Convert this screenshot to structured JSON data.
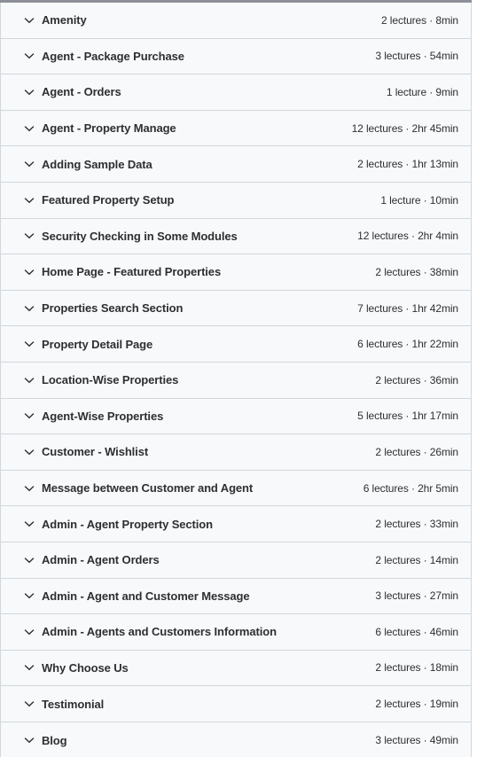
{
  "accordion": {
    "icon": "chevron-down-icon",
    "colors": {
      "row_background": "#f7f9fa",
      "border": "#d1d7dc",
      "title_text": "#2d2f31",
      "meta_text": "#2d2f31",
      "top_edge": "#8d9099"
    },
    "sections": [
      {
        "title": "Amenity",
        "lectures": "2 lectures",
        "duration": "8min",
        "meta": "2 lectures · 8min"
      },
      {
        "title": "Agent - Package Purchase",
        "lectures": "3 lectures",
        "duration": "54min",
        "meta": "3 lectures · 54min"
      },
      {
        "title": "Agent - Orders",
        "lectures": "1 lecture",
        "duration": "9min",
        "meta": "1 lecture · 9min"
      },
      {
        "title": "Agent - Property Manage",
        "lectures": "12 lectures",
        "duration": "2hr 45min",
        "meta": "12 lectures · 2hr 45min"
      },
      {
        "title": "Adding Sample Data",
        "lectures": "2 lectures",
        "duration": "1hr 13min",
        "meta": "2 lectures · 1hr 13min"
      },
      {
        "title": "Featured Property Setup",
        "lectures": "1 lecture",
        "duration": "10min",
        "meta": "1 lecture · 10min"
      },
      {
        "title": "Security Checking in Some Modules",
        "lectures": "12 lectures",
        "duration": "2hr 4min",
        "meta": "12 lectures · 2hr 4min"
      },
      {
        "title": "Home Page - Featured Properties",
        "lectures": "2 lectures",
        "duration": "38min",
        "meta": "2 lectures · 38min"
      },
      {
        "title": "Properties Search Section",
        "lectures": "7 lectures",
        "duration": "1hr 42min",
        "meta": "7 lectures · 1hr 42min"
      },
      {
        "title": "Property Detail Page",
        "lectures": "6 lectures",
        "duration": "1hr 22min",
        "meta": "6 lectures · 1hr 22min"
      },
      {
        "title": "Location-Wise Properties",
        "lectures": "2 lectures",
        "duration": "36min",
        "meta": "2 lectures · 36min"
      },
      {
        "title": "Agent-Wise Properties",
        "lectures": "5 lectures",
        "duration": "1hr 17min",
        "meta": "5 lectures · 1hr 17min"
      },
      {
        "title": "Customer - Wishlist",
        "lectures": "2 lectures",
        "duration": "26min",
        "meta": "2 lectures · 26min"
      },
      {
        "title": "Message between Customer and Agent",
        "lectures": "6 lectures",
        "duration": "2hr 5min",
        "meta": "6 lectures · 2hr 5min"
      },
      {
        "title": "Admin - Agent Property Section",
        "lectures": "2 lectures",
        "duration": "33min",
        "meta": "2 lectures · 33min"
      },
      {
        "title": "Admin - Agent Orders",
        "lectures": "2 lectures",
        "duration": "14min",
        "meta": "2 lectures · 14min"
      },
      {
        "title": "Admin - Agent and Customer Message",
        "lectures": "3 lectures",
        "duration": "27min",
        "meta": "3 lectures · 27min"
      },
      {
        "title": "Admin - Agents and Customers Information",
        "lectures": "6 lectures",
        "duration": "46min",
        "meta": "6 lectures · 46min"
      },
      {
        "title": "Why Choose Us",
        "lectures": "2 lectures",
        "duration": "18min",
        "meta": "2 lectures · 18min"
      },
      {
        "title": "Testimonial",
        "lectures": "2 lectures",
        "duration": "19min",
        "meta": "2 lectures · 19min"
      },
      {
        "title": "Blog",
        "lectures": "3 lectures",
        "duration": "49min",
        "meta": "3 lectures · 49min"
      }
    ]
  }
}
